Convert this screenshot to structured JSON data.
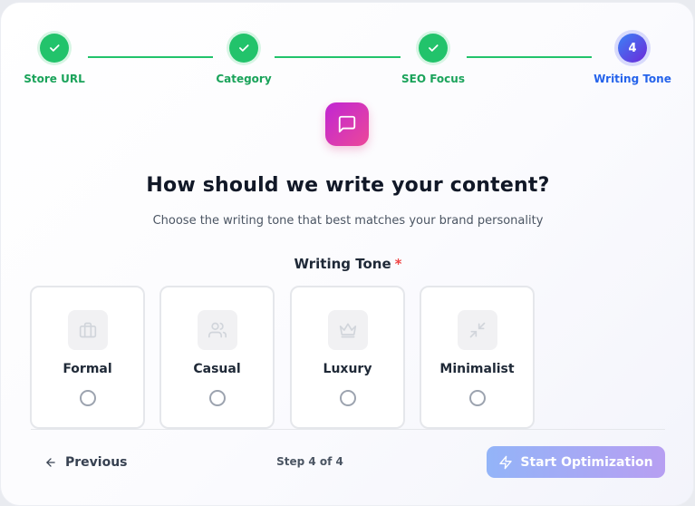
{
  "stepper": {
    "steps": [
      {
        "label": "Store URL",
        "status": "completed",
        "icon": "check-icon"
      },
      {
        "label": "Category",
        "status": "completed",
        "icon": "check-icon"
      },
      {
        "label": "SEO Focus",
        "status": "completed",
        "icon": "check-icon"
      },
      {
        "label": "Writing Tone",
        "status": "active",
        "number": "4"
      }
    ],
    "complete_color": "#22c36b",
    "active_color": "#2563eb"
  },
  "header": {
    "icon": "message-square-icon",
    "title": "How should we write your content?",
    "subtitle": "Choose the writing tone that best matches your brand personality"
  },
  "field": {
    "label": "Writing Tone",
    "required_mark": "*"
  },
  "tones": [
    {
      "label": "Formal",
      "icon": "briefcase-icon",
      "selected": false
    },
    {
      "label": "Casual",
      "icon": "users-icon",
      "selected": false
    },
    {
      "label": "Luxury",
      "icon": "crown-icon",
      "selected": false
    },
    {
      "label": "Minimalist",
      "icon": "minimize-icon",
      "selected": false
    }
  ],
  "footer": {
    "previous_label": "Previous",
    "step_text": "Step 4 of 4",
    "start_label": "Start Optimization",
    "start_icon": "zap-icon"
  }
}
